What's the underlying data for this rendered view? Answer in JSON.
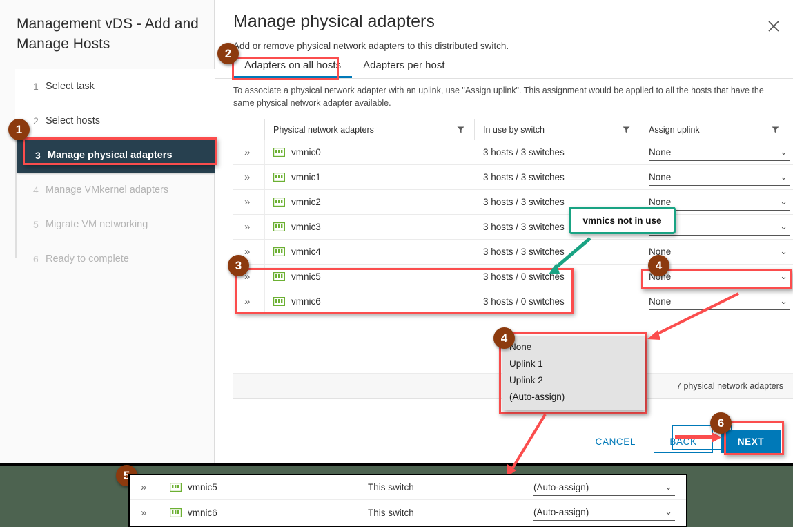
{
  "wizard": {
    "title": "Management vDS - Add and Manage Hosts",
    "steps": [
      {
        "num": "1",
        "label": "Select task",
        "state": "done"
      },
      {
        "num": "2",
        "label": "Select hosts",
        "state": "done"
      },
      {
        "num": "3",
        "label": "Manage physical adapters",
        "state": "active"
      },
      {
        "num": "4",
        "label": "Manage VMkernel adapters",
        "state": "future"
      },
      {
        "num": "5",
        "label": "Migrate VM networking",
        "state": "future"
      },
      {
        "num": "6",
        "label": "Ready to complete",
        "state": "future"
      }
    ]
  },
  "header": {
    "title": "Manage physical adapters",
    "subtitle": "Add or remove physical network adapters to this distributed switch.",
    "close_icon": "close-icon"
  },
  "tabs": [
    {
      "label": "Adapters on all hosts",
      "selected": true
    },
    {
      "label": "Adapters per host",
      "selected": false
    }
  ],
  "hint": "To associate a physical network adapter with an uplink, use \"Assign uplink\". This assignment would be applied to all the hosts that have the same physical network adapter available.",
  "table": {
    "columns": [
      "Physical network adapters",
      "In use by switch",
      "Assign uplink"
    ],
    "rows": [
      {
        "name": "vmnic0",
        "in_use": "3 hosts / 3 switches",
        "uplink": "None"
      },
      {
        "name": "vmnic1",
        "in_use": "3 hosts / 3 switches",
        "uplink": "None"
      },
      {
        "name": "vmnic2",
        "in_use": "3 hosts / 3 switches",
        "uplink": "None"
      },
      {
        "name": "vmnic3",
        "in_use": "3 hosts / 3 switches",
        "uplink": "None"
      },
      {
        "name": "vmnic4",
        "in_use": "3 hosts / 3 switches",
        "uplink": "None"
      },
      {
        "name": "vmnic5",
        "in_use": "3 hosts / 0 switches",
        "uplink": "None"
      },
      {
        "name": "vmnic6",
        "in_use": "3 hosts / 0 switches",
        "uplink": "None"
      }
    ],
    "footer_count": "7 physical network adapters"
  },
  "uplink_dropdown": {
    "options": [
      "None",
      "Uplink 1",
      "Uplink 2",
      "(Auto-assign)"
    ]
  },
  "footer": {
    "cancel": "CANCEL",
    "back": "BACK",
    "next": "NEXT"
  },
  "annotations": {
    "badges": [
      "1",
      "2",
      "3",
      "4",
      "4",
      "5",
      "6"
    ],
    "callout": "vmnics not in use",
    "highlight_color": "#fb4d4d",
    "callout_color": "#19a383",
    "badge_color": "#8c3a0e",
    "accent_color": "#0079b8",
    "progress_color": "#62a420"
  },
  "inset": {
    "rows": [
      {
        "name": "vmnic5",
        "in_use": "This switch",
        "uplink": "(Auto-assign)"
      },
      {
        "name": "vmnic6",
        "in_use": "This switch",
        "uplink": "(Auto-assign)"
      }
    ]
  }
}
